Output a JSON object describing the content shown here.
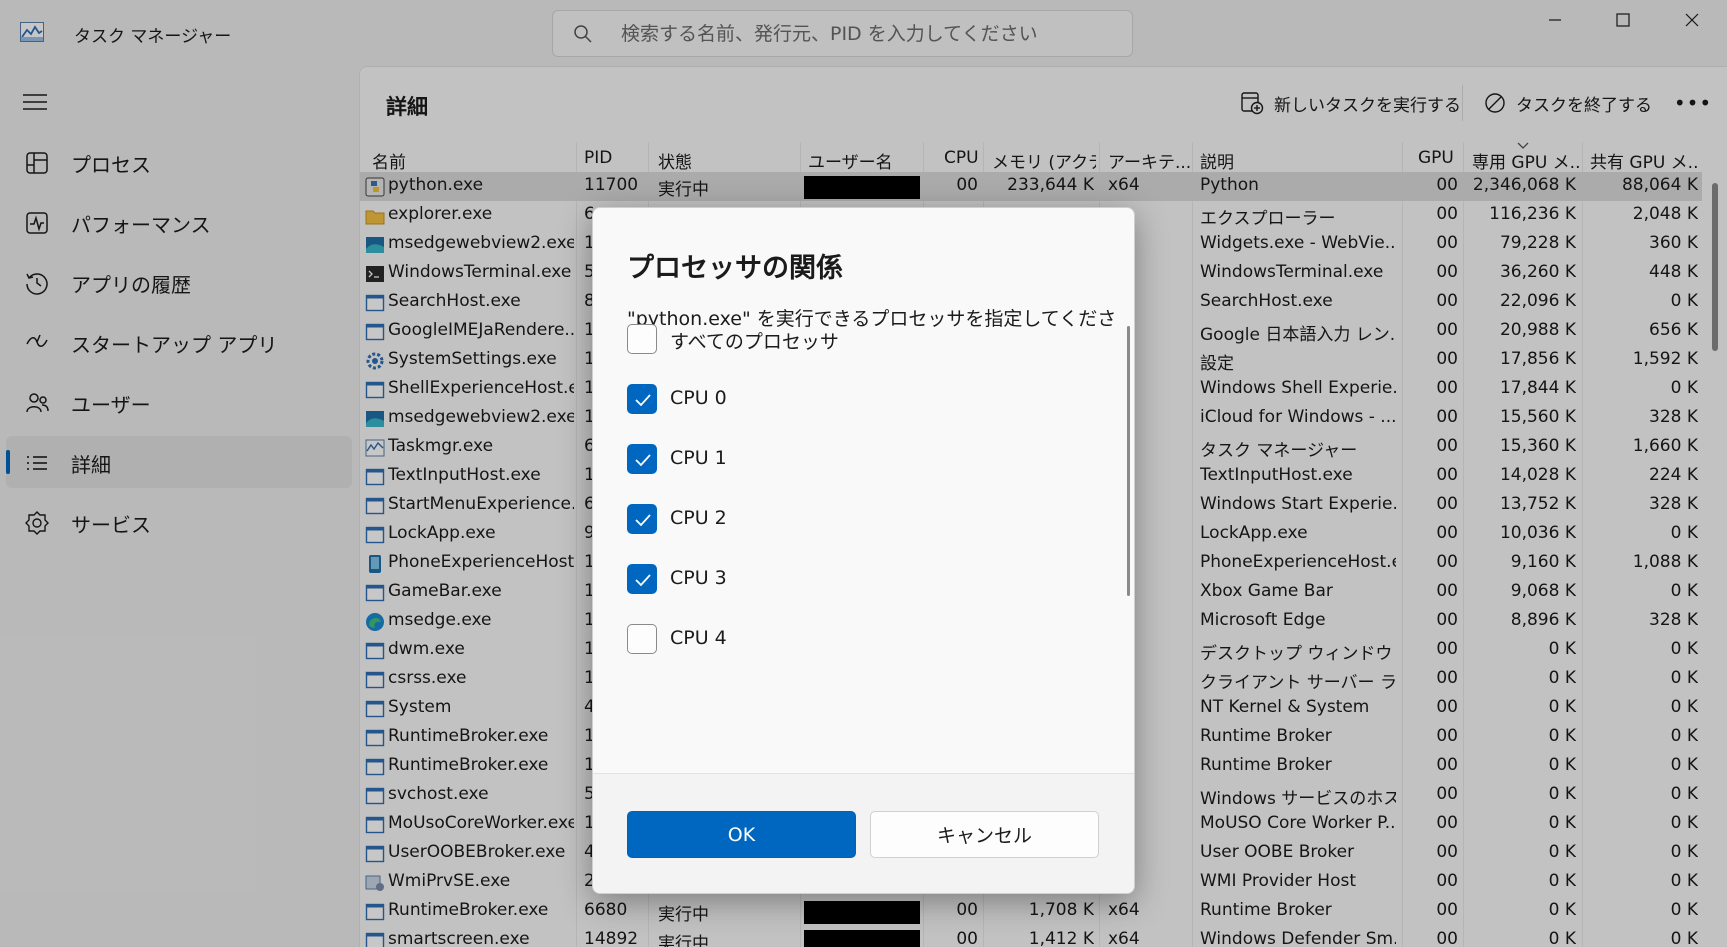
{
  "app": {
    "title": "タスク マネージャー"
  },
  "search": {
    "placeholder": "検索する名前、発行元、PID を入力してください"
  },
  "sidebar": {
    "items": [
      {
        "label": "プロセス",
        "icon": "processes-icon"
      },
      {
        "label": "パフォーマンス",
        "icon": "performance-icon"
      },
      {
        "label": "アプリの履歴",
        "icon": "app-history-icon"
      },
      {
        "label": "スタートアップ アプリ",
        "icon": "startup-apps-icon"
      },
      {
        "label": "ユーザー",
        "icon": "users-icon"
      },
      {
        "label": "詳細",
        "icon": "details-icon",
        "active": true
      },
      {
        "label": "サービス",
        "icon": "services-icon"
      }
    ]
  },
  "main": {
    "title": "詳細",
    "new_task_label": "新しいタスクを実行する",
    "end_task_label": "タスクを終了する",
    "more_label": "•••"
  },
  "table": {
    "columns": [
      "名前",
      "PID",
      "状態",
      "ユーザー名",
      "CPU",
      "メモリ (アクテ...",
      "アーキテ...",
      "説明",
      "GPU",
      "専用 GPU メ...",
      "共有 GPU メ..."
    ],
    "rows": [
      {
        "name": "python.exe",
        "pid": "11700",
        "status": "実行中",
        "cpu": "00",
        "memory": "233,644 K",
        "arch": "x64",
        "desc": "Python",
        "gpu": "00",
        "dedicated": "2,346,068 K",
        "shared": "88,064 K",
        "selected": true,
        "icon": "python-icon"
      },
      {
        "name": "explorer.exe",
        "pid": "6",
        "status": "",
        "cpu": "",
        "memory": "",
        "arch": "",
        "desc": "エクスプローラー",
        "gpu": "00",
        "dedicated": "116,236 K",
        "shared": "2,048 K",
        "icon": "folder-icon"
      },
      {
        "name": "msedgewebview2.exe",
        "pid": "1",
        "status": "",
        "cpu": "",
        "memory": "",
        "arch": "",
        "desc": "Widgets.exe - WebVie...",
        "gpu": "00",
        "dedicated": "79,228 K",
        "shared": "360 K",
        "icon": "webview-icon"
      },
      {
        "name": "WindowsTerminal.exe",
        "pid": "5",
        "status": "",
        "cpu": "",
        "memory": "",
        "arch": "",
        "desc": "WindowsTerminal.exe",
        "gpu": "00",
        "dedicated": "36,260 K",
        "shared": "448 K",
        "icon": "terminal-icon"
      },
      {
        "name": "SearchHost.exe",
        "pid": "8",
        "status": "",
        "cpu": "",
        "memory": "",
        "arch": "",
        "desc": "SearchHost.exe",
        "gpu": "00",
        "dedicated": "22,096 K",
        "shared": "0 K",
        "icon": "window-icon"
      },
      {
        "name": "GoogleIMEJaRendere...",
        "pid": "1",
        "status": "",
        "cpu": "",
        "memory": "",
        "arch": "",
        "desc": "Google 日本語入力 レン...",
        "gpu": "00",
        "dedicated": "20,988 K",
        "shared": "656 K",
        "icon": "window-icon"
      },
      {
        "name": "SystemSettings.exe",
        "pid": "1",
        "status": "",
        "cpu": "",
        "memory": "",
        "arch": "",
        "desc": "設定",
        "gpu": "00",
        "dedicated": "17,856 K",
        "shared": "1,592 K",
        "icon": "gear-icon"
      },
      {
        "name": "ShellExperienceHost.e...",
        "pid": "1",
        "status": "",
        "cpu": "",
        "memory": "",
        "arch": "",
        "desc": "Windows Shell Experie...",
        "gpu": "00",
        "dedicated": "17,844 K",
        "shared": "0 K",
        "icon": "window-icon"
      },
      {
        "name": "msedgewebview2.exe",
        "pid": "1",
        "status": "",
        "cpu": "",
        "memory": "",
        "arch": "",
        "desc": "iCloud for Windows - ...",
        "gpu": "00",
        "dedicated": "15,560 K",
        "shared": "328 K",
        "icon": "webview-icon"
      },
      {
        "name": "Taskmgr.exe",
        "pid": "6",
        "status": "",
        "cpu": "",
        "memory": "",
        "arch": "",
        "desc": "タスク マネージャー",
        "gpu": "00",
        "dedicated": "15,360 K",
        "shared": "1,660 K",
        "icon": "taskmgr-icon"
      },
      {
        "name": "TextInputHost.exe",
        "pid": "1",
        "status": "",
        "cpu": "",
        "memory": "",
        "arch": "",
        "desc": "TextInputHost.exe",
        "gpu": "00",
        "dedicated": "14,028 K",
        "shared": "224 K",
        "icon": "window-icon"
      },
      {
        "name": "StartMenuExperience...",
        "pid": "6",
        "status": "",
        "cpu": "",
        "memory": "",
        "arch": "",
        "desc": "Windows Start Experie...",
        "gpu": "00",
        "dedicated": "13,752 K",
        "shared": "328 K",
        "icon": "window-icon"
      },
      {
        "name": "LockApp.exe",
        "pid": "9",
        "status": "",
        "cpu": "",
        "memory": "",
        "arch": "",
        "desc": "LockApp.exe",
        "gpu": "00",
        "dedicated": "10,036 K",
        "shared": "0 K",
        "icon": "window-icon"
      },
      {
        "name": "PhoneExperienceHost...",
        "pid": "1",
        "status": "",
        "cpu": "",
        "memory": "",
        "arch": "",
        "desc": "PhoneExperienceHost.e...",
        "gpu": "00",
        "dedicated": "9,160 K",
        "shared": "1,088 K",
        "icon": "phone-icon"
      },
      {
        "name": "GameBar.exe",
        "pid": "1",
        "status": "",
        "cpu": "",
        "memory": "",
        "arch": "",
        "desc": "Xbox Game Bar",
        "gpu": "00",
        "dedicated": "9,068 K",
        "shared": "0 K",
        "icon": "window-icon"
      },
      {
        "name": "msedge.exe",
        "pid": "1",
        "status": "",
        "cpu": "",
        "memory": "",
        "arch": "",
        "desc": "Microsoft Edge",
        "gpu": "00",
        "dedicated": "8,896 K",
        "shared": "328 K",
        "icon": "edge-icon"
      },
      {
        "name": "dwm.exe",
        "pid": "1",
        "status": "",
        "cpu": "",
        "memory": "",
        "arch": "",
        "desc": "デスクトップ ウィンドウ マネ...",
        "gpu": "00",
        "dedicated": "0 K",
        "shared": "0 K",
        "icon": "window-icon"
      },
      {
        "name": "csrss.exe",
        "pid": "1",
        "status": "",
        "cpu": "",
        "memory": "",
        "arch": "",
        "desc": "クライアント サーバー ランタ...",
        "gpu": "00",
        "dedicated": "0 K",
        "shared": "0 K",
        "icon": "window-icon"
      },
      {
        "name": "System",
        "pid": "4",
        "status": "",
        "cpu": "",
        "memory": "",
        "arch": "",
        "desc": "NT Kernel & System",
        "gpu": "00",
        "dedicated": "0 K",
        "shared": "0 K",
        "icon": "window-icon"
      },
      {
        "name": "RuntimeBroker.exe",
        "pid": "1",
        "status": "",
        "cpu": "",
        "memory": "",
        "arch": "",
        "desc": "Runtime Broker",
        "gpu": "00",
        "dedicated": "0 K",
        "shared": "0 K",
        "icon": "window-icon"
      },
      {
        "name": "RuntimeBroker.exe",
        "pid": "1",
        "status": "",
        "cpu": "",
        "memory": "",
        "arch": "",
        "desc": "Runtime Broker",
        "gpu": "00",
        "dedicated": "0 K",
        "shared": "0 K",
        "icon": "window-icon"
      },
      {
        "name": "svchost.exe",
        "pid": "5",
        "status": "",
        "cpu": "",
        "memory": "",
        "arch": "",
        "desc": "Windows サービスのホス...",
        "gpu": "00",
        "dedicated": "0 K",
        "shared": "0 K",
        "icon": "window-icon"
      },
      {
        "name": "MoUsoCoreWorker.exe",
        "pid": "1",
        "status": "",
        "cpu": "",
        "memory": "",
        "arch": "",
        "desc": "MoUSO Core Worker P...",
        "gpu": "00",
        "dedicated": "0 K",
        "shared": "0 K",
        "icon": "window-icon"
      },
      {
        "name": "UserOOBEBroker.exe",
        "pid": "4",
        "status": "",
        "cpu": "",
        "memory": "",
        "arch": "",
        "desc": "User OOBE Broker",
        "gpu": "00",
        "dedicated": "0 K",
        "shared": "0 K",
        "icon": "window-icon"
      },
      {
        "name": "WmiPrvSE.exe",
        "pid": "2",
        "status": "",
        "cpu": "",
        "memory": "",
        "arch": "",
        "desc": "WMI Provider Host",
        "gpu": "00",
        "dedicated": "0 K",
        "shared": "0 K",
        "icon": "wmi-icon"
      },
      {
        "name": "RuntimeBroker.exe",
        "pid": "6680",
        "status": "実行中",
        "cpu": "00",
        "memory": "1,708 K",
        "arch": "x64",
        "desc": "Runtime Broker",
        "gpu": "00",
        "dedicated": "0 K",
        "shared": "0 K",
        "icon": "window-icon"
      },
      {
        "name": "smartscreen.exe",
        "pid": "14892",
        "status": "実行中",
        "cpu": "00",
        "memory": "1,412 K",
        "arch": "x64",
        "desc": "Windows Defender Sm...",
        "gpu": "00",
        "dedicated": "0 K",
        "shared": "0 K",
        "icon": "window-icon"
      }
    ]
  },
  "dialog": {
    "title": "プロセッサの関係",
    "description": "\"python.exe\" を実行できるプロセッサを指定してください。",
    "options": [
      {
        "label": "すべてのプロセッサ",
        "checked": false
      },
      {
        "label": "CPU 0",
        "checked": true
      },
      {
        "label": "CPU 1",
        "checked": true
      },
      {
        "label": "CPU 2",
        "checked": true
      },
      {
        "label": "CPU 3",
        "checked": true
      },
      {
        "label": "CPU 4",
        "checked": false
      }
    ],
    "ok_label": "OK",
    "cancel_label": "キャンセル"
  },
  "colors": {
    "accent": "#0067c0"
  }
}
